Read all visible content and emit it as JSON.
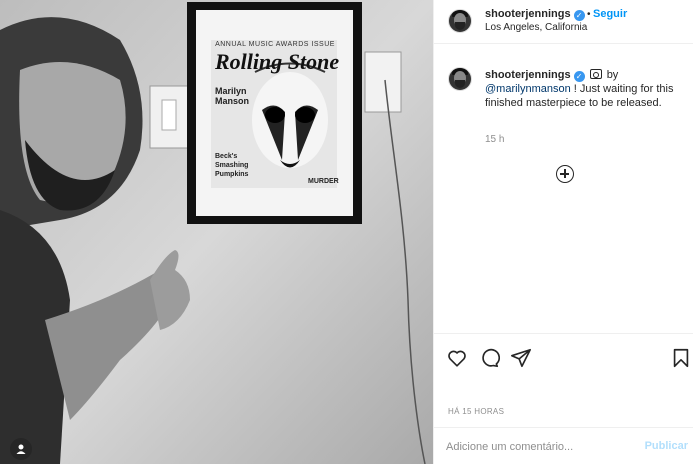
{
  "post": {
    "username": "shooterjennings",
    "verified_glyph": "✓",
    "dot": "•",
    "follow_label": "Seguir",
    "location": "Los Angeles, California"
  },
  "caption": {
    "username": "shooterjennings",
    "word_by": "by",
    "mention": "@marilynmanson",
    "text": " ! Just waiting for this finished masterpiece to be released.",
    "time_ago": "15 h"
  },
  "photo": {
    "magazine_masthead": "Rolling Stone",
    "magazine_banner": "ANNUAL MUSIC AWARDS ISSUE",
    "cover_lines": [
      "Marilyn",
      "Manson"
    ],
    "cover_lines_2": [
      "Beck's",
      "Smashing",
      "Pumpkins"
    ],
    "cover_right": "MURDER"
  },
  "footer": {
    "date_label": "HÁ 15 HORAS",
    "comment_placeholder": "Adicione um comentário...",
    "publish_label": "Publicar"
  },
  "icons": {
    "like": "heart-icon",
    "comment": "comment-icon",
    "share": "paper-plane-icon",
    "save": "bookmark-icon",
    "user_tag": "user-icon",
    "camera": "camera-icon",
    "more": "plus-circle-icon"
  }
}
